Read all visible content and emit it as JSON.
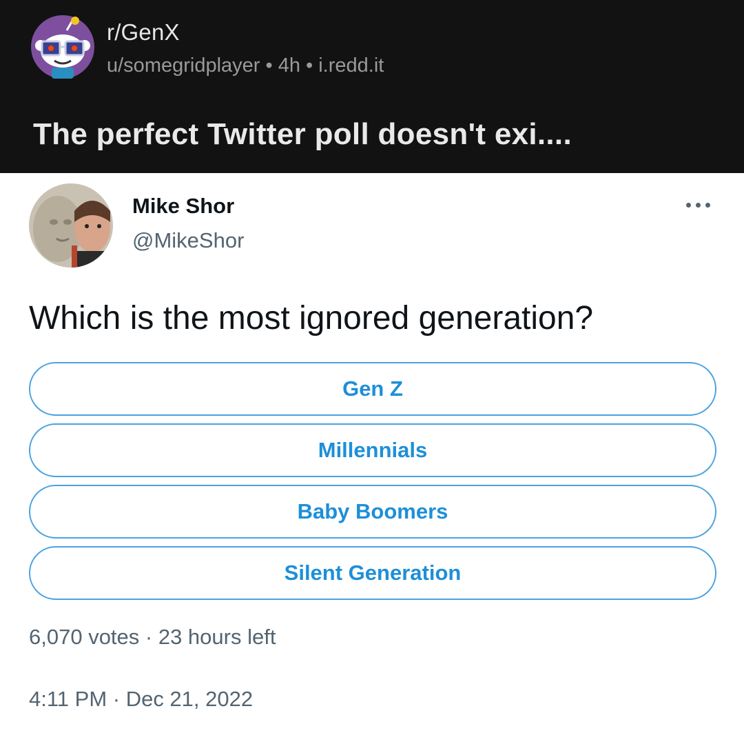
{
  "reddit": {
    "subreddit": "r/GenX",
    "meta": "u/somegridplayer • 4h • i.redd.it",
    "title": "The perfect Twitter poll doesn't exi....",
    "avatar_icon": "snoo-glasses-icon"
  },
  "tweet": {
    "author_name": "Mike Shor",
    "author_handle": "@MikeShor",
    "more_icon": "more-options-icon",
    "question": "Which is the most ignored generation?",
    "poll_options": [
      {
        "label": "Gen Z"
      },
      {
        "label": "Millennials"
      },
      {
        "label": "Baby Boomers"
      },
      {
        "label": "Silent Generation"
      }
    ],
    "poll_footer": "6,070 votes · 23 hours left",
    "timestamp": "4:11 PM · Dec 21, 2022"
  },
  "colors": {
    "header_bg": "#121212",
    "poll_accent": "#1d8fd8",
    "poll_border": "#4aa3df",
    "muted_text": "#536471"
  }
}
